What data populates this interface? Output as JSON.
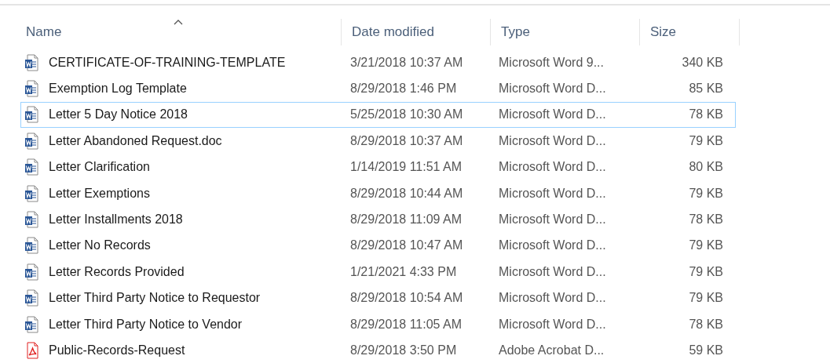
{
  "columns": [
    {
      "label": "Name",
      "sorted": true
    },
    {
      "label": "Date modified",
      "sorted": false
    },
    {
      "label": "Type",
      "sorted": false
    },
    {
      "label": "Size",
      "sorted": false
    }
  ],
  "rows": [
    {
      "kind": "word",
      "name": "CERTIFICATE-OF-TRAINING-TEMPLATE",
      "date": "3/21/2018 10:37 AM",
      "type": "Microsoft Word 9...",
      "size": "340 KB",
      "focused": false
    },
    {
      "kind": "word",
      "name": "Exemption Log Template",
      "date": "8/29/2018 1:46 PM",
      "type": "Microsoft Word D...",
      "size": "85 KB",
      "focused": false
    },
    {
      "kind": "word",
      "name": "Letter 5 Day Notice 2018",
      "date": "5/25/2018 10:30 AM",
      "type": "Microsoft Word D...",
      "size": "78 KB",
      "focused": true
    },
    {
      "kind": "word",
      "name": "Letter Abandoned Request.doc",
      "date": "8/29/2018 10:37 AM",
      "type": "Microsoft Word D...",
      "size": "79 KB",
      "focused": false
    },
    {
      "kind": "word",
      "name": "Letter Clarification",
      "date": "1/14/2019 11:51 AM",
      "type": "Microsoft Word D...",
      "size": "80 KB",
      "focused": false
    },
    {
      "kind": "word",
      "name": "Letter Exemptions",
      "date": "8/29/2018 10:44 AM",
      "type": "Microsoft Word D...",
      "size": "79 KB",
      "focused": false
    },
    {
      "kind": "word",
      "name": "Letter Installments 2018",
      "date": "8/29/2018 11:09 AM",
      "type": "Microsoft Word D...",
      "size": "78 KB",
      "focused": false
    },
    {
      "kind": "word",
      "name": "Letter No Records",
      "date": "8/29/2018 10:47 AM",
      "type": "Microsoft Word D...",
      "size": "79 KB",
      "focused": false
    },
    {
      "kind": "word",
      "name": "Letter Records Provided",
      "date": "1/21/2021 4:33 PM",
      "type": "Microsoft Word D...",
      "size": "79 KB",
      "focused": false
    },
    {
      "kind": "word",
      "name": "Letter Third Party Notice to Requestor",
      "date": "8/29/2018 10:54 AM",
      "type": "Microsoft Word D...",
      "size": "79 KB",
      "focused": false
    },
    {
      "kind": "word",
      "name": "Letter Third Party Notice to Vendor",
      "date": "8/29/2018 11:05 AM",
      "type": "Microsoft Word D...",
      "size": "78 KB",
      "focused": false
    },
    {
      "kind": "pdf",
      "name": "Public-Records-Request",
      "date": "8/29/2018 3:50 PM",
      "type": "Adobe Acrobat D...",
      "size": "59 KB",
      "focused": false
    }
  ]
}
